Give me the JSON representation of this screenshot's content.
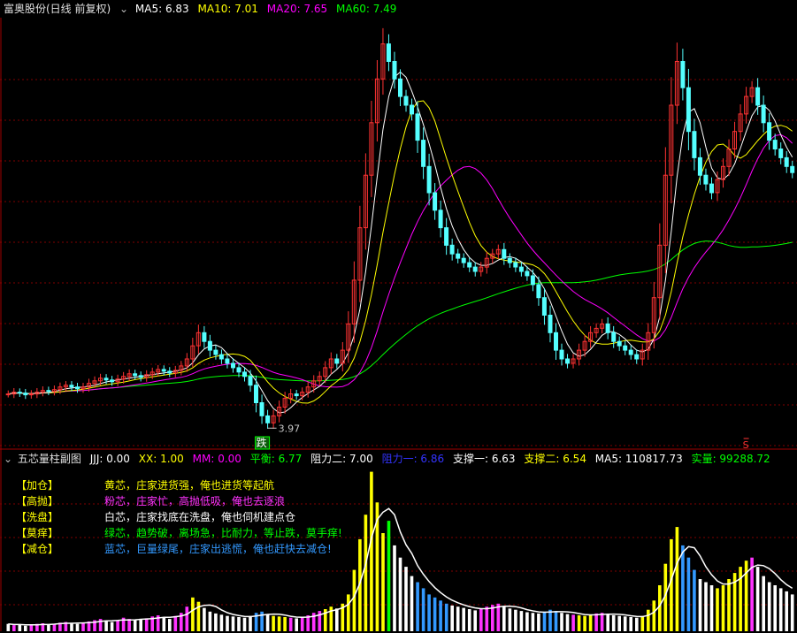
{
  "main": {
    "title": "富奥股份(日线 前复权)",
    "ma5": "MA5: 6.83",
    "ma10": "MA10: 7.01",
    "ma20": "MA20: 7.65",
    "ma60": "MA60: 7.49",
    "low_label": "3.97",
    "die_badge": "跌",
    "sell_mark": "S"
  },
  "sub": {
    "title": "五芯量柱副图",
    "jjj": "JJJ: 0.00",
    "xx": "XX: 1.00",
    "mm": "MM: 0.00",
    "pingheng": "平衡: 6.77",
    "zuli2": "阻力二: 7.00",
    "zuli1": "阻力一: 6.86",
    "zhicheng1": "支撑一: 6.63",
    "zhicheng2": "支撑二: 6.54",
    "ma5": "MA5: 110817.73",
    "shiliang": "实量: 99288.72",
    "legend": [
      {
        "tag": "【加仓】",
        "text": "黄芯，庄家进货强，俺也进货等起航",
        "color": "#ffff00"
      },
      {
        "tag": "【高抛】",
        "text": "粉芯，庄家忙，高抛低吸，俺也去逐浪",
        "color": "#ff33ff"
      },
      {
        "tag": "【洗盘】",
        "text": "白芯，庄家找底在洗盘，俺也伺机建点仓",
        "color": "#ffffff"
      },
      {
        "tag": "【莫痒】",
        "text": "绿芯，趋势破，离场急，比耐力，等止跌，莫手痒!",
        "color": "#00ff00"
      },
      {
        "tag": "【减仓】",
        "text": "蓝芯，巨量绿尾，庄家出逃慌，俺也赶快去减仓!",
        "color": "#3399ff"
      }
    ]
  },
  "colors": {
    "up": "#ff3333",
    "down": "#54ffff",
    "ma5": "#ffffff",
    "ma10": "#ffff00",
    "ma20": "#ff00ff",
    "ma60": "#00ff00",
    "grid": "#800000"
  },
  "chart_data": [
    {
      "type": "candlestick",
      "title": "富奥股份(日线 前复权)",
      "ylim": [
        3.7,
        8.6
      ],
      "annotations": [
        {
          "label": "3.97",
          "value": 3.97
        }
      ],
      "series": [
        {
          "name": "MA5",
          "value": 6.83
        },
        {
          "name": "MA10",
          "value": 7.01
        },
        {
          "name": "MA20",
          "value": 7.65
        },
        {
          "name": "MA60",
          "value": 7.49
        }
      ],
      "close": [
        4.3,
        4.32,
        4.31,
        4.29,
        4.3,
        4.32,
        4.34,
        4.33,
        4.35,
        4.38,
        4.4,
        4.38,
        4.36,
        4.38,
        4.42,
        4.45,
        4.48,
        4.46,
        4.44,
        4.47,
        4.5,
        4.53,
        4.51,
        4.49,
        4.52,
        4.55,
        4.58,
        4.56,
        4.54,
        4.57,
        4.62,
        4.7,
        4.85,
        5.0,
        4.9,
        4.8,
        4.75,
        4.7,
        4.65,
        4.6,
        4.55,
        4.5,
        4.4,
        4.2,
        4.05,
        3.97,
        4.05,
        4.15,
        4.25,
        4.3,
        4.28,
        4.32,
        4.38,
        4.45,
        4.5,
        4.6,
        4.7,
        4.65,
        4.8,
        5.1,
        5.6,
        6.2,
        6.8,
        7.4,
        7.9,
        8.3,
        8.1,
        7.9,
        7.7,
        7.6,
        7.5,
        7.2,
        6.9,
        6.6,
        6.4,
        6.2,
        6.0,
        5.9,
        5.85,
        5.8,
        5.75,
        5.7,
        5.75,
        5.85,
        5.9,
        5.95,
        5.85,
        5.8,
        5.75,
        5.7,
        5.65,
        5.55,
        5.4,
        5.2,
        5.0,
        4.8,
        4.7,
        4.65,
        4.7,
        4.8,
        4.9,
        5.0,
        5.05,
        5.1,
        5.0,
        4.9,
        4.85,
        4.8,
        4.75,
        4.7,
        4.8,
        5.0,
        5.4,
        6.0,
        6.8,
        7.6,
        8.1,
        7.8,
        7.3,
        7.0,
        6.8,
        6.7,
        6.6,
        6.75,
        6.9,
        7.1,
        7.3,
        7.5,
        7.7,
        7.8,
        7.6,
        7.4,
        7.2,
        7.1,
        7.0,
        6.9,
        6.83
      ]
    },
    {
      "type": "bar",
      "title": "五芯量柱副图",
      "series": [
        {
          "name": "JJJ",
          "value": 0.0
        },
        {
          "name": "XX",
          "value": 1.0
        },
        {
          "name": "MM",
          "value": 0.0
        },
        {
          "name": "平衡",
          "value": 6.77
        },
        {
          "name": "阻力二",
          "value": 7.0
        },
        {
          "name": "阻力一",
          "value": 6.86
        },
        {
          "name": "支撑一",
          "value": 6.63
        },
        {
          "name": "支撑二",
          "value": 6.54
        },
        {
          "name": "MA5",
          "value": 110817.73
        },
        {
          "name": "实量",
          "value": 99288.72
        }
      ],
      "volume_units": [
        1.2,
        1.0,
        1.1,
        0.9,
        1.0,
        1.2,
        1.3,
        1.1,
        1.2,
        1.4,
        1.5,
        1.3,
        1.2,
        1.4,
        1.6,
        1.8,
        2.0,
        1.7,
        1.5,
        1.8,
        2.2,
        2.0,
        1.8,
        1.9,
        2.1,
        2.4,
        2.6,
        2.3,
        2.0,
        2.5,
        3.0,
        4.0,
        5.5,
        4.8,
        3.8,
        3.2,
        2.9,
        2.7,
        2.5,
        2.4,
        2.3,
        2.2,
        2.5,
        3.0,
        3.2,
        2.8,
        2.5,
        2.4,
        2.3,
        2.2,
        2.1,
        2.3,
        2.6,
        3.0,
        3.3,
        3.6,
        4.0,
        3.7,
        4.5,
        6.0,
        10.0,
        15.0,
        19.0,
        26.0,
        21.0,
        16.0,
        18.0,
        14.0,
        12.0,
        10.5,
        9.0,
        8.0,
        7.0,
        6.0,
        5.5,
        5.0,
        4.5,
        4.2,
        4.0,
        3.8,
        3.6,
        3.4,
        3.6,
        4.0,
        4.3,
        4.5,
        4.0,
        3.7,
        3.5,
        3.3,
        3.1,
        3.0,
        2.9,
        3.2,
        3.5,
        3.3,
        3.0,
        2.8,
        2.7,
        2.6,
        2.5,
        2.7,
        2.9,
        3.0,
        2.8,
        2.6,
        2.5,
        2.4,
        2.3,
        2.2,
        2.5,
        3.5,
        5.0,
        7.5,
        11.0,
        15.0,
        17.0,
        14.0,
        12.0,
        10.0,
        8.5,
        8.0,
        7.5,
        7.0,
        7.5,
        8.5,
        9.5,
        10.5,
        11.5,
        12.0,
        10.5,
        9.0,
        8.0,
        7.5,
        7.0,
        6.5,
        6.0
      ]
    }
  ]
}
